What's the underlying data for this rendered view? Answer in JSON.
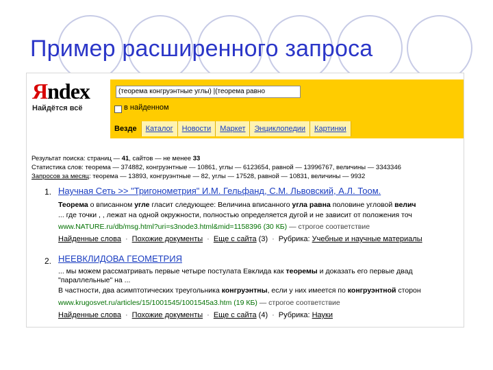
{
  "slide": {
    "title": "Пример расширенного запроса"
  },
  "logo": {
    "first": "Я",
    "rest": "ndex",
    "tagline": "Найдётся всё"
  },
  "search": {
    "query": "(теорема конгруэнтные углы) |(теорема равно",
    "checkbox_label": "в найденном",
    "tabs": [
      "Везде",
      "Каталог",
      "Новости",
      "Маркет",
      "Энциклопедии",
      "Картинки"
    ],
    "active_tab": "Везде"
  },
  "stats": {
    "line1_prefix": "Результат поиска: страниц — ",
    "pages": "41",
    "line1_mid": ", сайтов — не менее ",
    "sites": "33",
    "line2": "Статистика слов: теорема — 374882, конгруэнтные — 10861, углы — 6123654, равной — 13996767, величины — 3343346",
    "line3_label": "Запросов за месяц",
    "line3_rest": ": теорема — 13893, конгруэнтные — 82, углы — 17528, равной — 10831, величины — 9932"
  },
  "results": [
    {
      "num": "1.",
      "title": "Научная Сеть >> \"Тригонометрия\" И.М. Гельфанд, С.М. Львовский, А.Л. Тоом.",
      "line1_b1": "Теорема",
      "line1_t1": " о вписанном ",
      "line1_b2": "угле",
      "line1_t2": " гласит следующее: Величина вписанного ",
      "line1_b3": "угла равна",
      "line1_t3": " половине угловой ",
      "line1_b4": "велич",
      "line2": "... где точки , , лежат на одной окружности, полностью определяется дугой и не зависит от положения точ",
      "url": "www.NATURE.ru/db/msg.html?uri=s3node3.html&mid=1158396 (30 КБ)",
      "url_suffix": " — строгое соответствие",
      "link_found": "Найденные слова",
      "link_similar": "Похожие документы",
      "link_more": "Еще с сайта",
      "more_count": " (3)",
      "rubric_label": "Рубрика: ",
      "rubric": "Учебные и научные материалы"
    },
    {
      "num": "2.",
      "title": "НЕЕВКЛИДОВА ГЕОМЕТРИЯ",
      "line1_t1": "... мы можем рассматривать первые четыре постулата Евклида как ",
      "line1_b1": "теоремы",
      "line1_t2": " и доказать его первые двад",
      "line2": "\"параллельные\" на ...",
      "line3_t1": "В частности, два асимптотических треугольника ",
      "line3_b1": "конгруэнтны",
      "line3_t2": ", если у них имеется по ",
      "line3_b2": "конгруэнтной",
      "line3_t3": " сторон",
      "url": "www.krugosvet.ru/articles/15/1001545/1001545a3.htm (19 КБ)",
      "url_suffix": " — строгое соответствие",
      "link_found": "Найденные слова",
      "link_similar": "Похожие документы",
      "link_more": "Еще с сайта",
      "more_count": " (4)",
      "rubric_label": "Рубрика: ",
      "rubric": "Науки"
    }
  ],
  "colors": {
    "title": "#2b36c8",
    "yellow": "#ffcc00",
    "link": "#1a3dc1",
    "url": "#007000",
    "logo_red": "#d80000"
  }
}
